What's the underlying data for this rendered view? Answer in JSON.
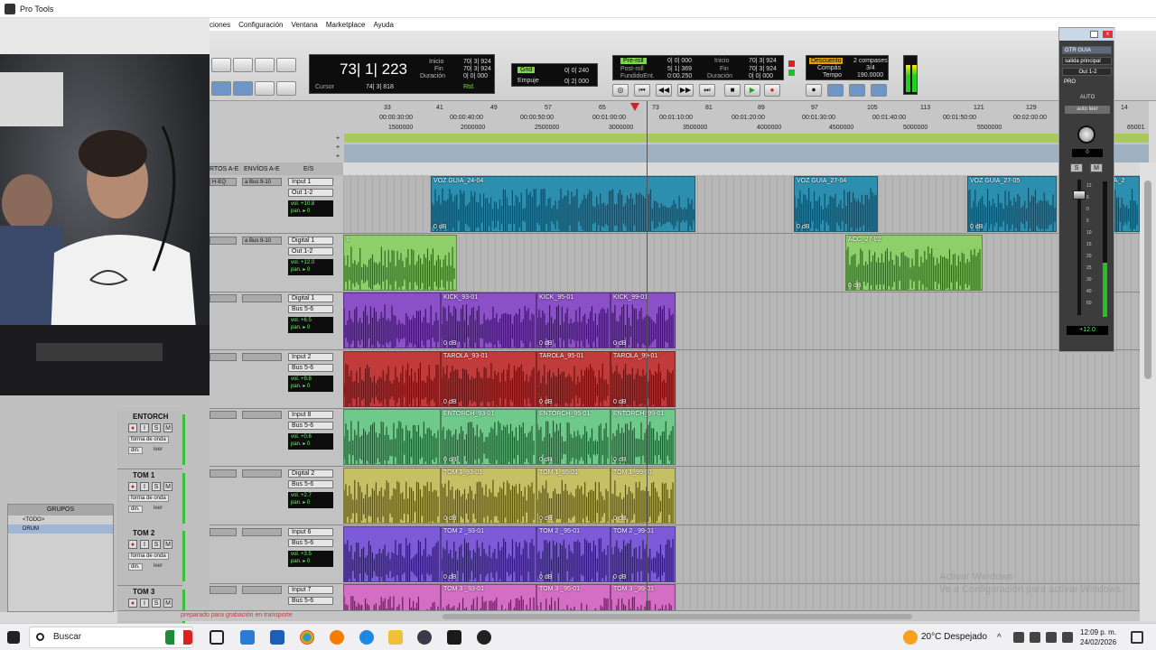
{
  "window": {
    "title": "Pro Tools"
  },
  "menu": [
    "ciones",
    "Configuración",
    "Ventana",
    "Marketplace",
    "Ayuda"
  ],
  "counter": {
    "main": "73| 1| 223",
    "cursor_label": "Cursor",
    "cursor_value": "74| 3| 818",
    "start_label": "Inicio",
    "end_label": "Fin",
    "length_label": "Duración",
    "start": "70| 3| 924",
    "end": "70| 3| 924",
    "length": "0| 0| 000",
    "nudge_label": "Rtd."
  },
  "grid": {
    "grid_label": "Grid",
    "grid_value": "0| 0| 240",
    "nudge_label": "Empuje",
    "nudge_value": "0| 2| 000"
  },
  "preroll": {
    "pre": "Pre-roll",
    "post": "Post-roll",
    "fade": "FundidoEnt.",
    "pre_v": "0| 0| 000",
    "post_v": "5| 1| 369",
    "fade_v": "0:00.250",
    "start_label": "Inicio",
    "end_label": "Fin",
    "length_label": "Duración",
    "start": "70| 3| 924",
    "end": "70| 3| 924",
    "length": "0| 0| 000"
  },
  "countoff": {
    "label": "Descuento",
    "bars": "2 compases",
    "meter_label": "Compás",
    "meter": "3/4",
    "tempo_label": "Tempo",
    "tempo": "190.0000"
  },
  "ruler": {
    "bars": [
      "33",
      "41",
      "49",
      "57",
      "65",
      "73",
      "81",
      "89",
      "97",
      "105",
      "113",
      "121",
      "129",
      "14"
    ],
    "times": [
      "00:00:30:00",
      "00:00:40:00",
      "00:00:50:00",
      "00:01:00:00",
      "00:01:10:00",
      "00:01:20:00",
      "00:01:30:00",
      "00:01:40:00",
      "00:01:50:00",
      "00:02:00:00"
    ],
    "samples": [
      "1500000",
      "2000000",
      "2500000",
      "3000000",
      "3500000",
      "4000000",
      "4500000",
      "5000000",
      "5500000",
      "65001"
    ]
  },
  "columns": {
    "inserts": "RTOS A-E",
    "sends": "ENVÍOS A-E",
    "io": "E/S"
  },
  "io_rows": [
    {
      "send": "a Bus 9-10",
      "insert": "H-EQ",
      "input": "Input 1",
      "output": "Out 1-2",
      "vol": "+10.8",
      "pan": "0"
    },
    {
      "send": "a Bus 9-10",
      "insert": "",
      "input": "Digital 1",
      "output": "Out 1-2",
      "vol": "+12.0",
      "pan": "0"
    },
    {
      "send": "",
      "insert": "",
      "input": "Digital 1",
      "output": "Bus 5-6",
      "vol": "+6.5",
      "pan": "0"
    },
    {
      "send": "",
      "insert": "",
      "input": "Input 2",
      "output": "Bus 5-6",
      "vol": "+9.8",
      "pan": "0"
    },
    {
      "send": "",
      "insert": "",
      "input": "Input 8",
      "output": "Bus 5-6",
      "vol": "+0.6",
      "pan": "0"
    },
    {
      "send": "",
      "insert": "",
      "input": "Digital 2",
      "output": "Bus 5-6",
      "vol": "+2.7",
      "pan": "0"
    },
    {
      "send": "",
      "insert": "",
      "input": "Input 6",
      "output": "Bus 5-6",
      "vol": "+3.5",
      "pan": "0"
    },
    {
      "send": "",
      "insert": "",
      "input": "Input 7",
      "output": "Bus 5-6",
      "vol": "",
      "pan": ""
    }
  ],
  "io_labels": {
    "vol": "vol.",
    "pan": "pan.",
    "pan_prefix": "▸"
  },
  "tracks": [
    {
      "name": "ENTORCH",
      "view": "forma de onda",
      "dyn": "din.",
      "auto": "leer"
    },
    {
      "name": "TOM 1",
      "view": "forma de onda",
      "dyn": "din.",
      "auto": "leer"
    },
    {
      "name": "TOM 2",
      "view": "forma de onda",
      "dyn": "din.",
      "auto": "leer"
    },
    {
      "name": "TOM 3",
      "view": "",
      "dyn": "",
      "auto": ""
    }
  ],
  "track_buttons": {
    "s": "S",
    "m": "M",
    "i": "I"
  },
  "groups": {
    "title": "GRUPOS",
    "items": [
      "<TODO>",
      "DRUM"
    ]
  },
  "clips": {
    "lane0": [
      {
        "name": "VOZ GUIA_24-04",
        "db": "0 dB"
      },
      {
        "name": "VOZ GUIA_27-04",
        "db": "0 dB"
      },
      {
        "name": "VOZ GUIA_27-05",
        "db": "0 dB"
      },
      {
        "name": "IA_2",
        "db": ""
      }
    ],
    "lane1": [
      {
        "name": "1",
        "db": ""
      },
      {
        "name": "ACC_27-02",
        "db": "0 dB"
      }
    ],
    "lane2": [
      {
        "name": "",
        "db": ""
      },
      {
        "name": "KICK_93-01",
        "db": "0 dB"
      },
      {
        "name": "KICK_95-01",
        "db": "0 dB"
      },
      {
        "name": "KICK_99-01",
        "db": "0 dB"
      }
    ],
    "lane3": [
      {
        "name": "",
        "db": ""
      },
      {
        "name": "TAROLA_93-01",
        "db": "0 dB"
      },
      {
        "name": "TAROLA_95-01",
        "db": "0 dB"
      },
      {
        "name": "TAROLA_99-01",
        "db": "0 dB"
      }
    ],
    "lane4": [
      {
        "name": "",
        "db": ""
      },
      {
        "name": "ENTORCH_93-01",
        "db": "0 dB"
      },
      {
        "name": "ENTORCH_95-01",
        "db": "0 dB"
      },
      {
        "name": "ENTORCH_99-01",
        "db": "0 dB"
      }
    ],
    "lane5": [
      {
        "name": "",
        "db": ""
      },
      {
        "name": "TOM 1_93-01",
        "db": "0 dB"
      },
      {
        "name": "TOM 1_95-01",
        "db": "0 dB"
      },
      {
        "name": "TOM 1_99-01",
        "db": "0 dB"
      }
    ],
    "lane6": [
      {
        "name": "",
        "db": ""
      },
      {
        "name": "TOM 2 _93-01",
        "db": "0 dB"
      },
      {
        "name": "TOM 2 _95-01",
        "db": "0 dB"
      },
      {
        "name": "TOM 2 _99-01",
        "db": "0 dB"
      }
    ],
    "lane7": [
      {
        "name": "",
        "db": ""
      },
      {
        "name": "TOM 3 _93-01",
        "db": ""
      },
      {
        "name": "TOM 3 _95-01",
        "db": ""
      },
      {
        "name": "TOM 3 _99-01",
        "db": ""
      }
    ]
  },
  "mixer": {
    "name": "GTR GUIA",
    "output": "salida principal",
    "out": "Out 1-2",
    "pro": "PRO",
    "auto": "AUTO",
    "auto_mode": "auto leer",
    "pan": "0",
    "s": "S",
    "m": "M",
    "vol": "+12.0",
    "scale": [
      "12",
      "6",
      "0",
      "5",
      "10",
      "15",
      "20",
      "25",
      "30",
      "40",
      "60"
    ],
    "meter_scale": [
      "0",
      "3",
      "6",
      "10",
      "15",
      "20",
      "30",
      "40",
      "50",
      "60"
    ]
  },
  "status": "preparado para grabación en transporte",
  "watermark": {
    "line1": "Activar Windows",
    "line2": "Ve a Configuración para activar Windows."
  },
  "taskbar": {
    "search": "Buscar",
    "weather": "20°C  Despejado",
    "time": "12:09 p. m.",
    "date": "24/02/2026"
  },
  "colors": {
    "voz": "#2d8fb0",
    "acc": "#8ecf6a",
    "kick": "#8b4fc8",
    "tarola": "#c23b3b",
    "entorch": "#6fc98b",
    "tom1": "#c6c064",
    "tom2": "#7d5bd8",
    "tom3": "#d46ec4"
  }
}
